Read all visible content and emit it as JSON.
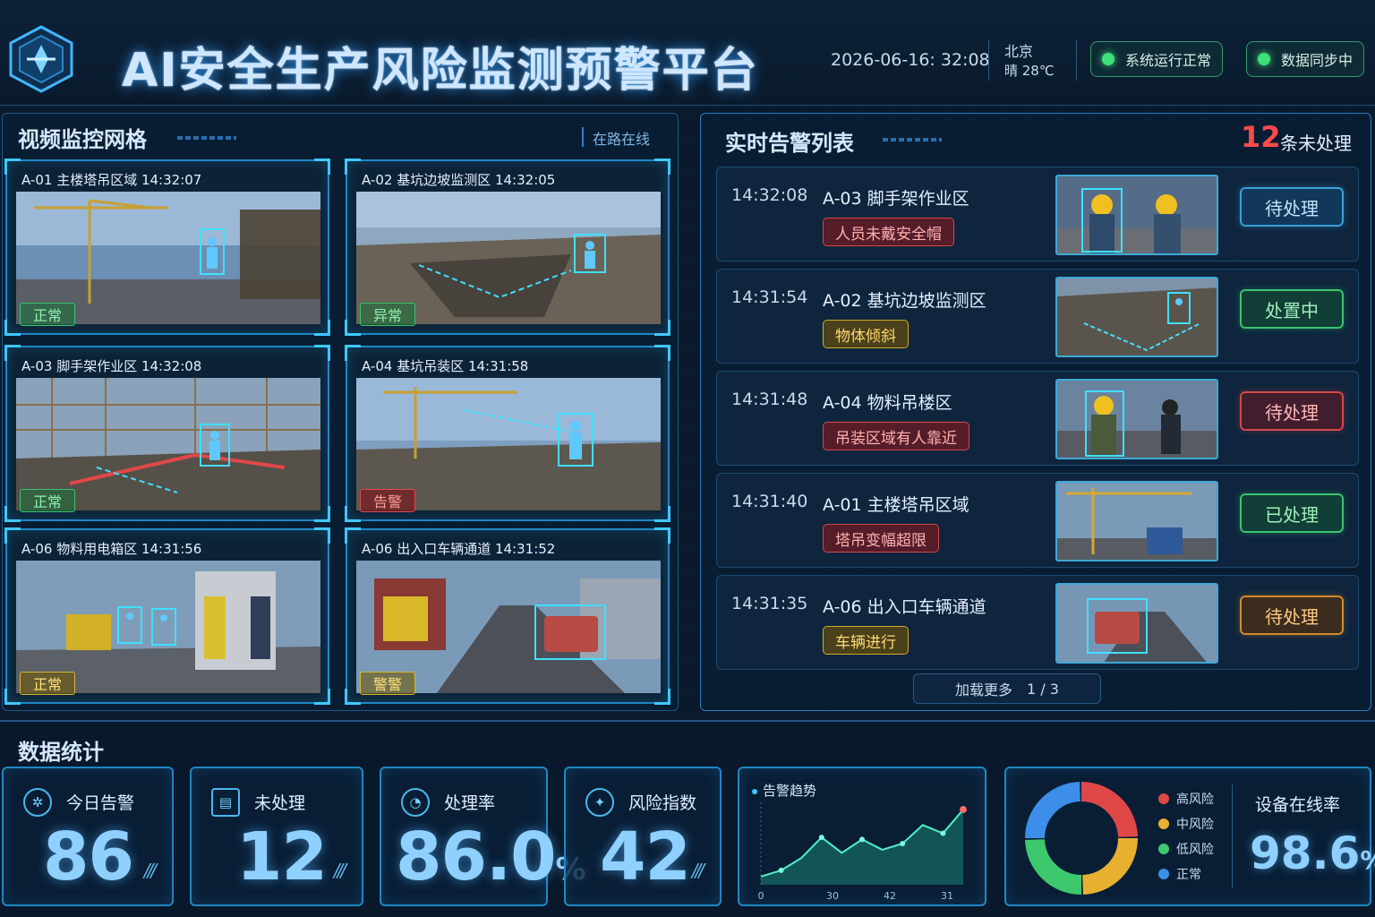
{
  "header": {
    "title": "AI安全生产风险监测预警平台",
    "datetime": "2026-06-16: 32:08",
    "city": "北京",
    "weather": "晴 28℃",
    "status_system": "系统运行正常",
    "status_sync": "数据同步中"
  },
  "video": {
    "title": "视频监控网格",
    "online_label": "在路在线",
    "tiles": [
      {
        "caption": "A-01  主楼塔吊区域  14:32:07",
        "status": "正常"
      },
      {
        "caption": "A-02  基坑边坡监测区  14:32:05",
        "status": "异常"
      },
      {
        "caption": "A-03  脚手架作业区  14:32:08",
        "status": "正常"
      },
      {
        "caption": "A-04  基坑吊装区  14:31:58",
        "status": "告警"
      },
      {
        "caption": "A-06  物料用电箱区  14:31:56",
        "status": "正常"
      },
      {
        "caption": "A-06  出入口车辆通道  14:31:52",
        "status": "警警"
      }
    ]
  },
  "alerts": {
    "title": "实时告警列表",
    "count": "12",
    "count_label": "条未处理",
    "items": [
      {
        "time": "14:32:08",
        "location": "A-03  脚手架作业区",
        "tag": "人员未戴安全帽",
        "action": "待处理"
      },
      {
        "time": "14:31:54",
        "location": "A-02  基坑边坡监测区",
        "tag": "物体倾斜",
        "action": "处置中"
      },
      {
        "time": "14:31:48",
        "location": "A-04  物料吊楼区",
        "tag": "吊装区域有人靠近",
        "action": "待处理"
      },
      {
        "time": "14:31:40",
        "location": "A-01  主楼塔吊区域",
        "tag": "塔吊变幅超限",
        "action": "已处理"
      },
      {
        "time": "14:31:35",
        "location": "A-06  出入口车辆通道",
        "tag": "车辆进行",
        "action": "待处理"
      }
    ],
    "load_more": "加载更多",
    "pager": "1 / 3"
  },
  "stats": {
    "title": "数据统计",
    "today_label": "今日告警",
    "today_value": "86",
    "pending_label": "未处理",
    "pending_value": "12",
    "rate_label": "处理率",
    "rate_value": "86.0",
    "rate_unit": "%",
    "risk_label": "风险指数",
    "risk_value": "42",
    "trend_title": "告警趋势",
    "trend_ticks": [
      "0",
      "30",
      "42",
      "31"
    ],
    "legend": [
      "高风险",
      "中风险",
      "低风险",
      "正常"
    ],
    "online_label": "设备在线率",
    "online_value": "98.6",
    "online_unit": "%"
  },
  "chart_data": {
    "type": "area",
    "title": "告警趋势",
    "x": [
      "0",
      "30",
      "42",
      "31"
    ],
    "values": [
      8,
      14,
      26,
      46,
      31,
      44,
      34,
      40,
      58,
      50,
      73
    ],
    "ylim": [
      0,
      80
    ]
  },
  "donut_data": {
    "type": "pie",
    "series": [
      {
        "name": "高风险",
        "value": 25,
        "color": "#e04848"
      },
      {
        "name": "中风险",
        "value": 25,
        "color": "#e8b030"
      },
      {
        "name": "低风险",
        "value": 25,
        "color": "#3ec86e"
      },
      {
        "name": "正常",
        "value": 25,
        "color": "#3c8ee8"
      }
    ]
  },
  "colors": {
    "accent": "#3fc8ff",
    "ok": "#3ac46e",
    "alert": "#e04848",
    "warn": "#d9b634"
  }
}
